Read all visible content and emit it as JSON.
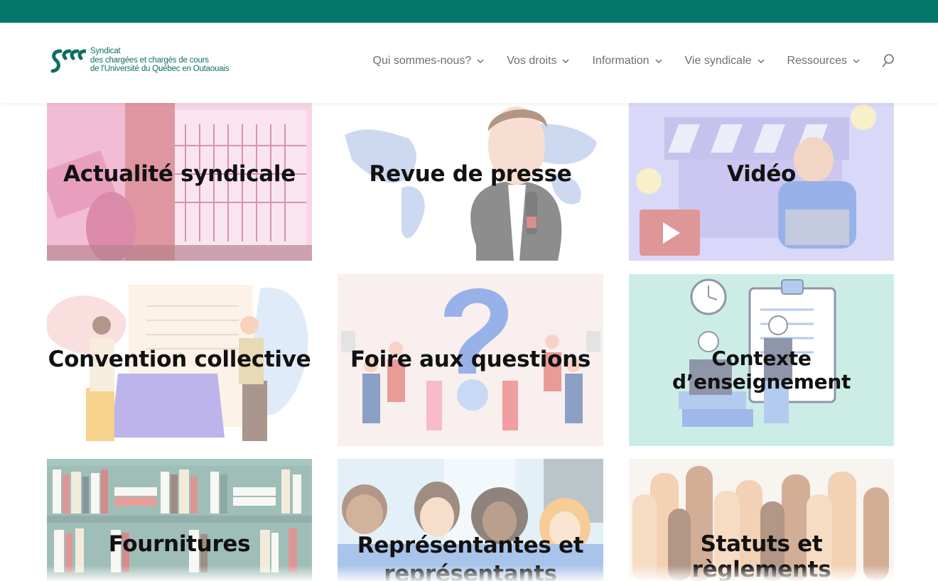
{
  "brand": {
    "line1": "Syndicat",
    "line2": "des chargées et chargés de cours",
    "line3": "de l'Université du Québec en Outaouais",
    "color": "#0c6f60"
  },
  "topbar_color": "#05776a",
  "nav": {
    "items": [
      "Qui sommes-nous?",
      "Vos droits",
      "Information",
      "Vie syndicale",
      "Ressources"
    ],
    "search_icon": "search-icon"
  },
  "tiles": [
    {
      "label": "Actualité syndicale"
    },
    {
      "label": "Revue de presse"
    },
    {
      "label": "Vidéo"
    },
    {
      "label": "Convention collective"
    },
    {
      "label": "Foire aux questions"
    },
    {
      "label": "Contexte d’enseignement"
    },
    {
      "label": "Fournitures"
    },
    {
      "label": "Représentantes et représentants"
    },
    {
      "label": "Statuts et règlements"
    }
  ]
}
